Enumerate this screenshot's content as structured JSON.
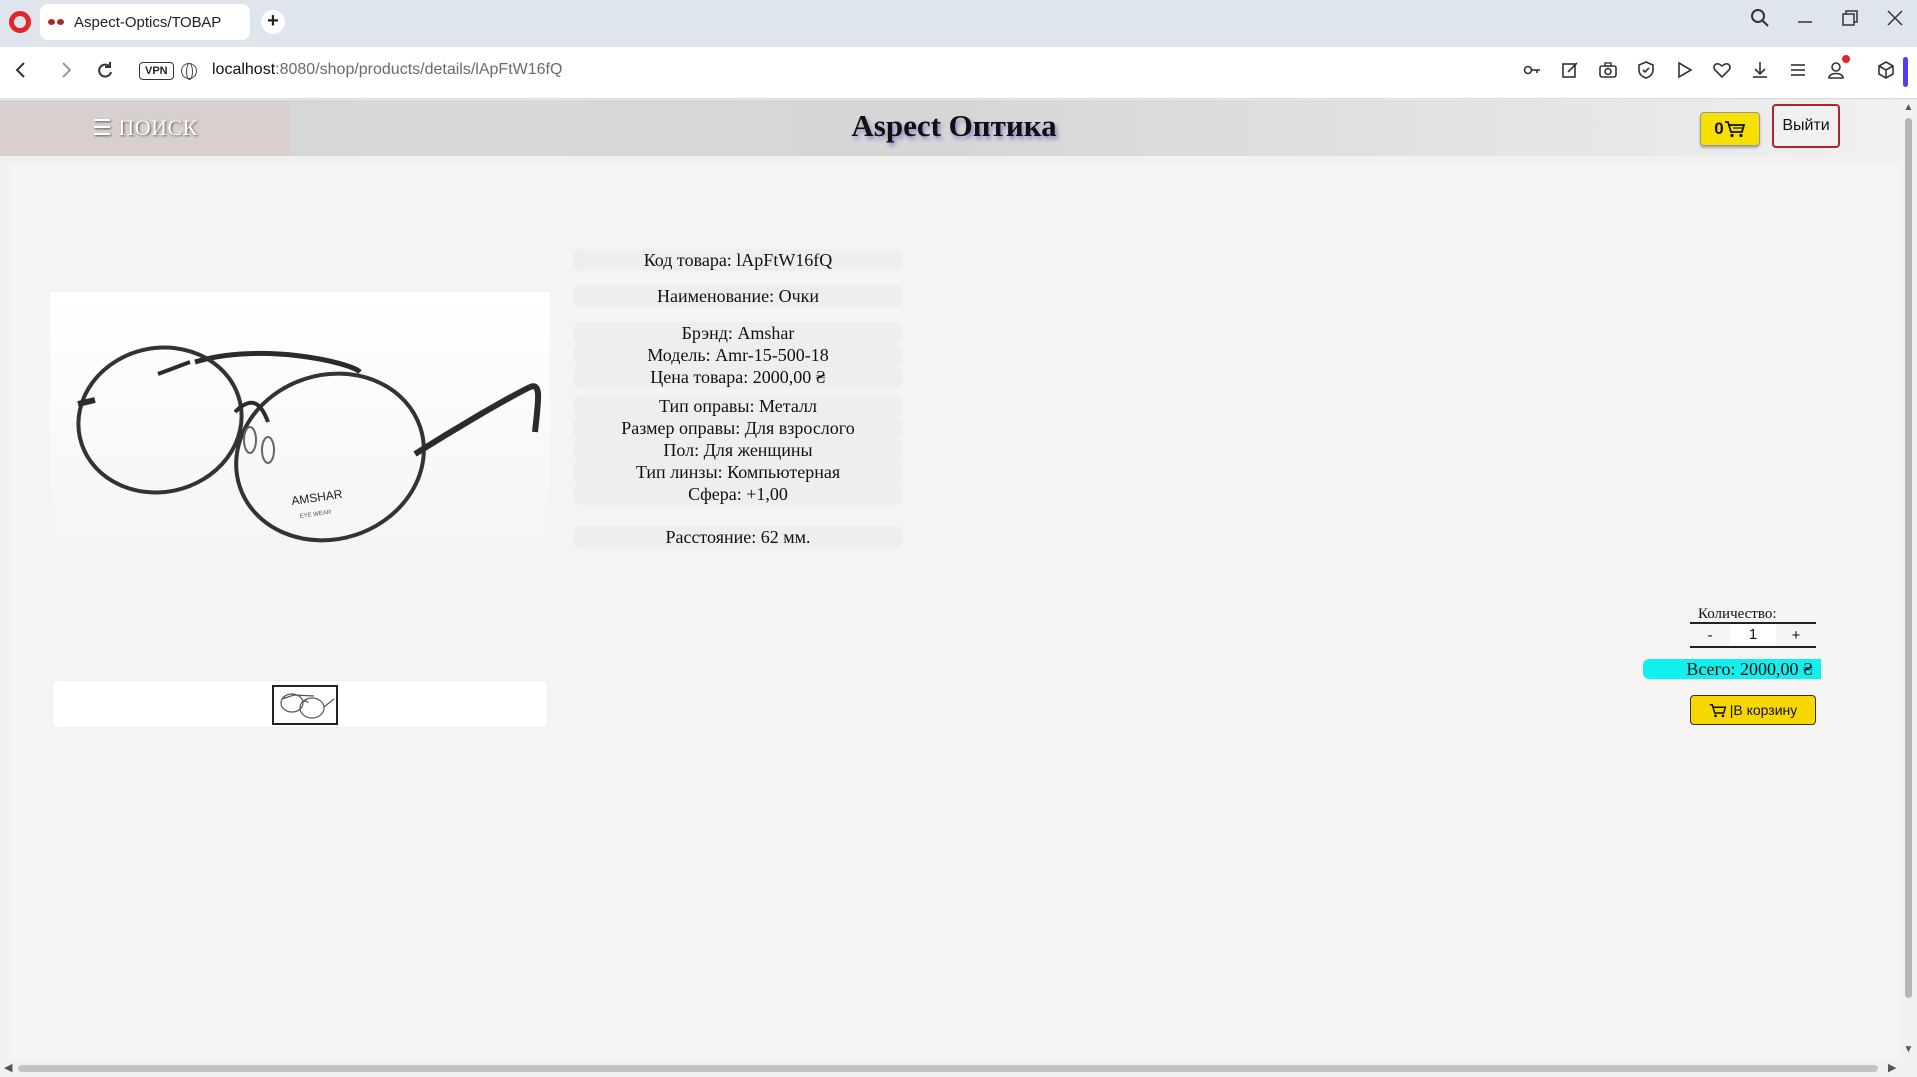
{
  "browser": {
    "tab_title": "Aspect-Optics/ТОВАР",
    "new_tab": "+",
    "url_host": "localhost",
    "url_rest": ":8080/shop/products/details/lApFtW16fQ",
    "vpn_label": "VPN"
  },
  "header": {
    "menu_label": "☰ ПОИСК",
    "site_title": "Aspect Оптика",
    "cart_count": "0",
    "logout_label": "Выйти"
  },
  "product": {
    "code": "Код товара: lApFtW16fQ",
    "name": "Наименование: Очки",
    "brand": "Брэнд: Amshar",
    "model": "Модель: Amr-15-500-18",
    "price": "Цена товара: 2000,00 ₴",
    "frame_type": "Тип оправы: Металл",
    "frame_size": "Размер оправы: Для взрослого",
    "gender": "Пол: Для женщины",
    "lens_type": "Тип линзы: Компьютерная",
    "sphere": "Сфера: +1,00",
    "distance": "Расстояние: 62 мм.",
    "image_brand": "AMSHAR",
    "image_sub": "EYE WEAR"
  },
  "purchase": {
    "quantity_label": "Количество:",
    "minus": "-",
    "quantity": "1",
    "plus": "+",
    "total": "Всего: 2000,00 ₴",
    "add_to_cart": "|В корзину"
  },
  "colors": {
    "cart_yellow": "#f6e000",
    "total_cyan": "#12f0ee",
    "logout_border": "#b3232b",
    "title_shadow": "#8a86c6"
  }
}
